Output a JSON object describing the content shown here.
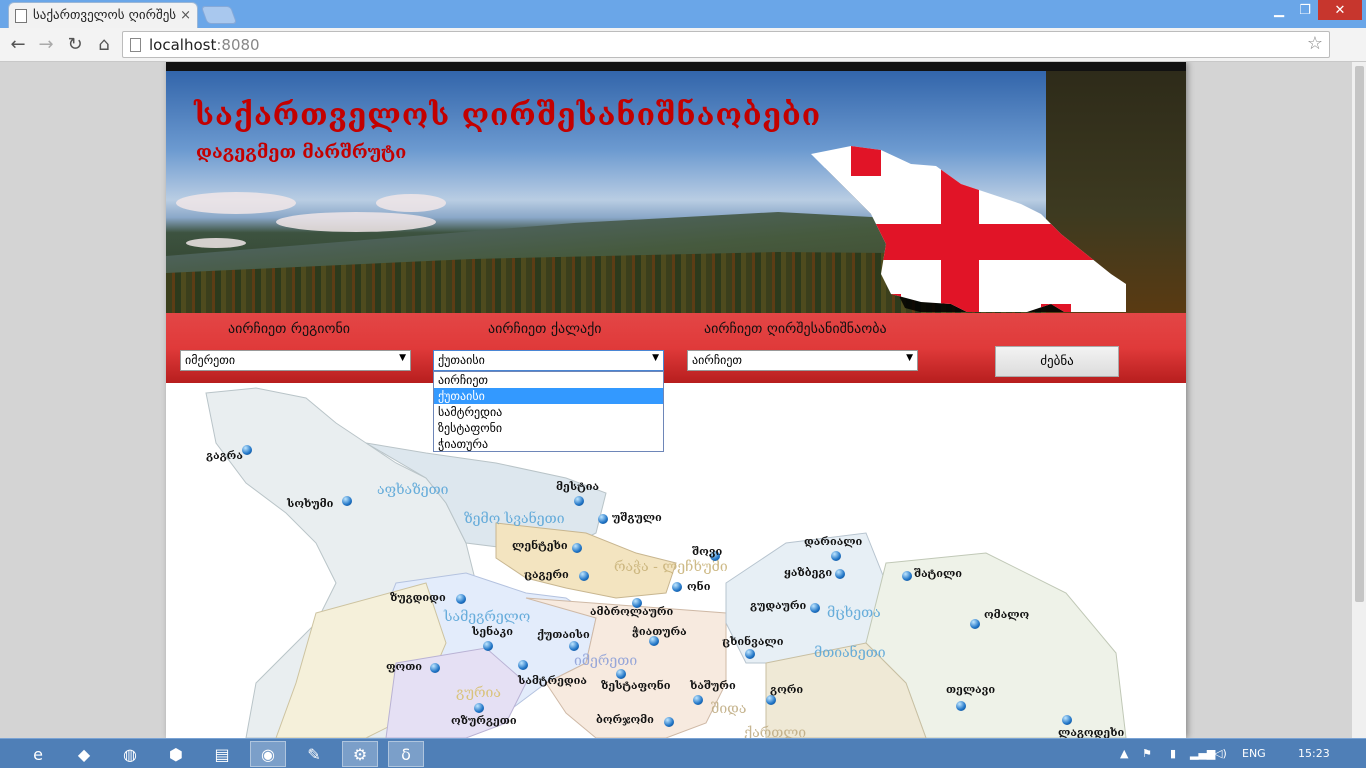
{
  "browser": {
    "tab_title": "საქართველოს ღირშესა",
    "tab_close": "×",
    "url_host": "localhost",
    "url_port": ":8080",
    "minimize": "▁",
    "maximize": "❐",
    "close": "✕"
  },
  "header": {
    "title": "საქართველოს ღირშესანიშნაობები",
    "subtitle": "დაგეგმეთ მარშრუტი"
  },
  "filters": {
    "region_label": "აირჩიეთ რეგიონი",
    "region_value": "იმერეთი",
    "city_label": "აირჩიეთ ქალაქი",
    "city_value": "ქუთაისი",
    "sight_label": "აირჩიეთ ღირშესანიშნაობა",
    "sight_value": "აირჩიეთ",
    "search_button": "ძებნა",
    "city_options": [
      "აირჩიეთ",
      "ქუთაისი",
      "სამტრედია",
      "ზესტაფონი",
      "ჭიათურა"
    ],
    "city_selected_index": 1
  },
  "map": {
    "cities": [
      {
        "name": "გაგრა"
      },
      {
        "name": "სოხუმი"
      },
      {
        "name": "მესტია"
      },
      {
        "name": "უშგული"
      },
      {
        "name": "ლენტეხი"
      },
      {
        "name": "შოვი"
      },
      {
        "name": "ცაგერი"
      },
      {
        "name": "ონი"
      },
      {
        "name": "ზუგდიდი"
      },
      {
        "name": "ამბროლაური"
      },
      {
        "name": "სენაკი"
      },
      {
        "name": "ქუთაისი"
      },
      {
        "name": "ჭიათურა"
      },
      {
        "name": "ფოთი"
      },
      {
        "name": "სამტრედია"
      },
      {
        "name": "ზესტაფონი"
      },
      {
        "name": "ოზურგეთი"
      },
      {
        "name": "ბორჯომი"
      },
      {
        "name": "დარიალი"
      },
      {
        "name": "ყაზბეგი"
      },
      {
        "name": "შატილი"
      },
      {
        "name": "გუდაური"
      },
      {
        "name": "ცხინვალი"
      },
      {
        "name": "ხაშური"
      },
      {
        "name": "გორი"
      },
      {
        "name": "ომალო"
      },
      {
        "name": "თელავი"
      },
      {
        "name": "ლაგოდეხი"
      }
    ],
    "regions": [
      {
        "name": "აფხაზეთი"
      },
      {
        "name": "ზემო სვანეთი"
      },
      {
        "name": "რაჭა - ლეჩხუმი"
      },
      {
        "name": "სამეგრელო"
      },
      {
        "name": "იმერეთი"
      },
      {
        "name": "მცხეთა"
      },
      {
        "name": "მთიანეთი"
      },
      {
        "name": "გურია"
      },
      {
        "name": "შიდა"
      },
      {
        "name": "ქართლი"
      }
    ]
  },
  "taskbar": {
    "language": "ENG",
    "time": "15:23"
  }
}
